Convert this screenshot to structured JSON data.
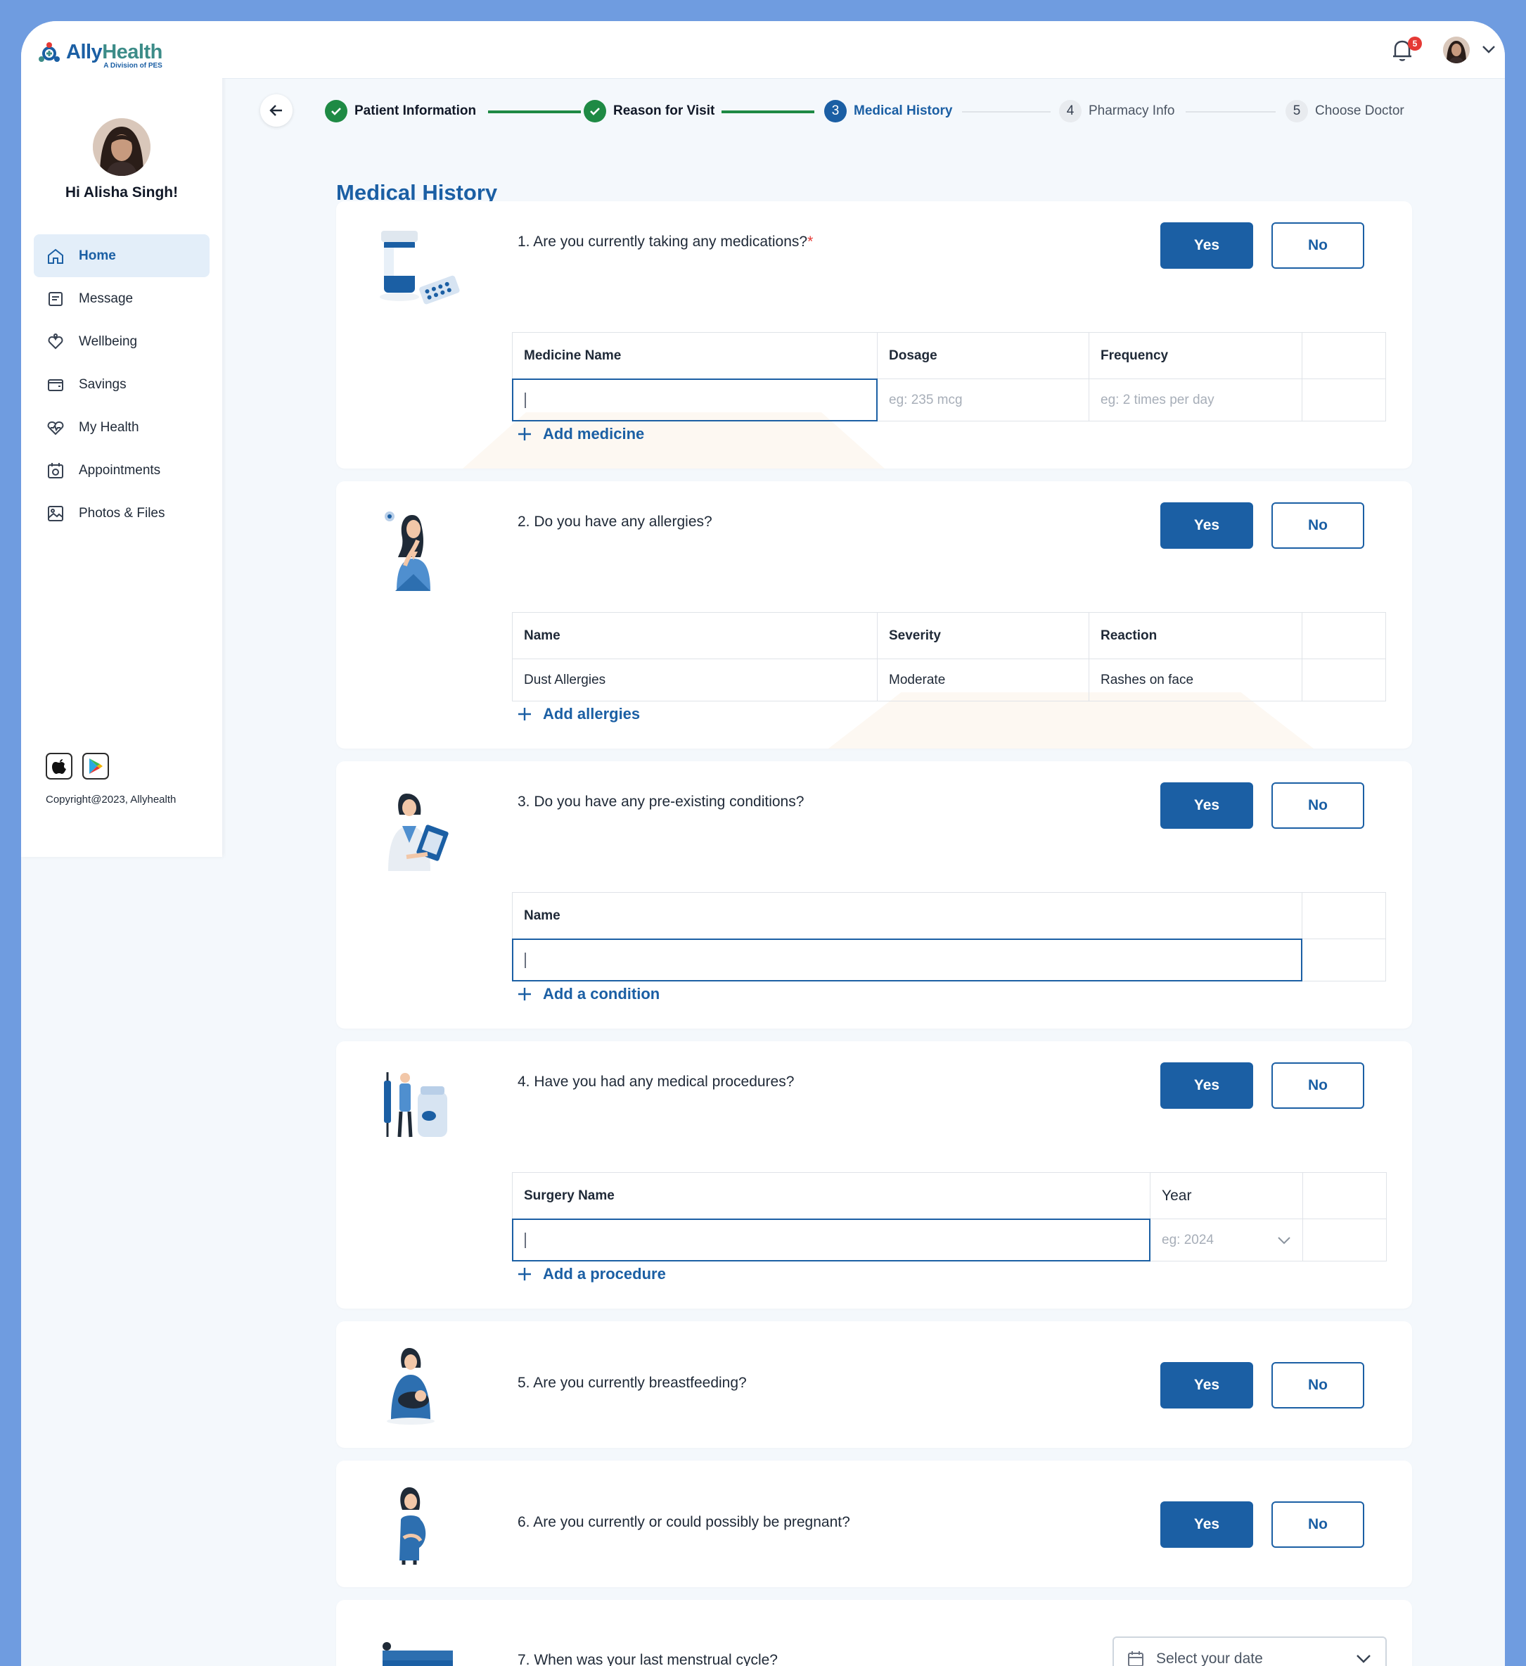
{
  "brand": {
    "name_part1": "Ally",
    "name_part2": "Health",
    "subtitle": "A Division of PES",
    "accent": "#1b5fa4",
    "success": "#1e8a44"
  },
  "user": {
    "greeting": "Hi Alisha Singh!"
  },
  "nav": [
    {
      "label": "Home",
      "icon": "home-icon",
      "active": true
    },
    {
      "label": "Message",
      "icon": "message-icon"
    },
    {
      "label": "Wellbeing",
      "icon": "wellbeing-icon"
    },
    {
      "label": "Savings",
      "icon": "wallet-icon"
    },
    {
      "label": "My Health",
      "icon": "heart-pulse-icon"
    },
    {
      "label": "Appointments",
      "icon": "calendar-icon"
    },
    {
      "label": "Photos & Files",
      "icon": "image-icon"
    }
  ],
  "footer": {
    "copyright": "Copyright@2023, Allyhealth"
  },
  "topbar": {
    "notification_count": "5"
  },
  "steps": [
    {
      "number": "1",
      "label": "Patient Information",
      "status": "done"
    },
    {
      "number": "2",
      "label": "Reason for Visit",
      "status": "done"
    },
    {
      "number": "3",
      "label": "Medical History",
      "status": "current"
    },
    {
      "number": "4",
      "label": "Pharmacy Info",
      "status": "todo"
    },
    {
      "number": "5",
      "label": "Choose Doctor",
      "status": "todo"
    }
  ],
  "page": {
    "title": "Medical History"
  },
  "buttons": {
    "yes": "Yes",
    "no": "No"
  },
  "questions": {
    "q1": {
      "text": "1. Are you currently taking any medications?",
      "required_mark": "*",
      "columns": [
        "Medicine Name",
        "Dosage",
        "Frequency"
      ],
      "placeholders": [
        "",
        "eg: 235 mcg",
        "eg: 2 times per day"
      ],
      "add_label": "Add medicine"
    },
    "q2": {
      "text": "2. Do you have any allergies?",
      "columns": [
        "Name",
        "Severity",
        "Reaction"
      ],
      "rows": [
        [
          "Dust Allergies",
          "Moderate",
          "Rashes on face"
        ]
      ],
      "add_label": "Add allergies"
    },
    "q3": {
      "text": "3. Do you have any pre-existing conditions?",
      "columns": [
        "Name"
      ],
      "add_label": "Add a condition"
    },
    "q4": {
      "text": "4. Have you had any medical procedures?",
      "columns": [
        "Surgery Name",
        "Year"
      ],
      "year_placeholder": "eg: 2024",
      "add_label": "Add a procedure"
    },
    "q5": {
      "text": "5. Are you currently breastfeeding?"
    },
    "q6": {
      "text": "6. Are you currently or could possibly be pregnant?"
    },
    "q7": {
      "text": "7. When was your last menstrual cycle?",
      "date_placeholder": "Select your date"
    }
  }
}
